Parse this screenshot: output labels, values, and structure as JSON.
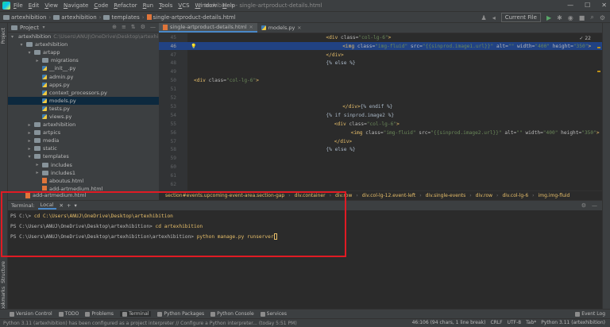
{
  "titlebar": {
    "menu": [
      "File",
      "Edit",
      "View",
      "Navigate",
      "Code",
      "Refactor",
      "Run",
      "Tools",
      "VCS",
      "Window",
      "Help"
    ],
    "window_title": "artexhibition - single-artproduct-details.html"
  },
  "navbar": {
    "crumbs": [
      "artexhibition",
      "artexhibition",
      "templates",
      "single-artproduct-details.html"
    ],
    "run_config": "Current File"
  },
  "sidebar": {
    "project_label": "Project",
    "structure_label": "Structure",
    "bookmarks_label": "Bookmarks",
    "tree": [
      {
        "label": "artexhibition",
        "path": "C:\\Users\\ANUJ\\OneDrive\\Desktop\\artexhibition",
        "type": "folder",
        "arrow": "▾",
        "indent": 0
      },
      {
        "label": "artexhibition",
        "type": "folder",
        "arrow": "▾",
        "indent": 1
      },
      {
        "label": "artapp",
        "type": "folder",
        "arrow": "▾",
        "indent": 2
      },
      {
        "label": "migrations",
        "type": "folder",
        "arrow": "▸",
        "indent": 3
      },
      {
        "label": "__init__.py",
        "type": "py",
        "arrow": "",
        "indent": 3
      },
      {
        "label": "admin.py",
        "type": "py",
        "arrow": "",
        "indent": 3
      },
      {
        "label": "apps.py",
        "type": "py",
        "arrow": "",
        "indent": 3
      },
      {
        "label": "context_processors.py",
        "type": "py",
        "arrow": "",
        "indent": 3
      },
      {
        "label": "models.py",
        "type": "py",
        "arrow": "",
        "indent": 3,
        "selected": true
      },
      {
        "label": "tests.py",
        "type": "py",
        "arrow": "",
        "indent": 3
      },
      {
        "label": "views.py",
        "type": "py",
        "arrow": "",
        "indent": 3
      },
      {
        "label": "artexhibition",
        "type": "folder",
        "arrow": "▸",
        "indent": 2
      },
      {
        "label": "artpics",
        "type": "folder",
        "arrow": "▸",
        "indent": 2
      },
      {
        "label": "media",
        "type": "folder",
        "arrow": "▸",
        "indent": 2
      },
      {
        "label": "static",
        "type": "folder",
        "arrow": "▸",
        "indent": 2
      },
      {
        "label": "templates",
        "type": "folder",
        "arrow": "▾",
        "indent": 2
      },
      {
        "label": "includes",
        "type": "folder",
        "arrow": "▸",
        "indent": 3
      },
      {
        "label": "includes1",
        "type": "folder",
        "arrow": "▸",
        "indent": 3
      },
      {
        "label": "aboutus.html",
        "type": "html",
        "arrow": "",
        "indent": 3
      },
      {
        "label": "add-artmedium.html",
        "type": "html",
        "arrow": "",
        "indent": 3
      }
    ],
    "extra_item": "add-artmedium.html"
  },
  "editor": {
    "tabs": [
      {
        "label": "single-artproduct-details.html",
        "active": true
      },
      {
        "label": "models.py",
        "active": false
      }
    ],
    "inspection": "✓ 22",
    "lines": [
      {
        "num": "45",
        "indent": 32,
        "segments": [
          {
            "t": "<div ",
            "c": "tag"
          },
          {
            "t": "class=",
            "c": "attr"
          },
          {
            "t": "\"col-lg-6\"",
            "c": "str"
          },
          {
            "t": ">",
            "c": "tag"
          }
        ]
      },
      {
        "num": "46",
        "indent": 36,
        "hl": true,
        "segments": [
          {
            "t": "<img ",
            "c": "tag"
          },
          {
            "t": "class=",
            "c": "attr"
          },
          {
            "t": "\"img-fluid\" ",
            "c": "str"
          },
          {
            "t": "src=",
            "c": "attr"
          },
          {
            "t": "\"{{sinprod.image1.url}}\" ",
            "c": "str"
          },
          {
            "t": "alt=",
            "c": "attr"
          },
          {
            "t": "\"\" ",
            "c": "str"
          },
          {
            "t": "width=",
            "c": "attr"
          },
          {
            "t": "\"400\" ",
            "c": "str"
          },
          {
            "t": "height=",
            "c": "attr"
          },
          {
            "t": "\"350\"",
            "c": "str"
          },
          {
            "t": ">",
            "c": "tag"
          }
        ]
      },
      {
        "num": "47",
        "indent": 32,
        "segments": [
          {
            "t": "</div>",
            "c": "tag"
          }
        ]
      },
      {
        "num": "48",
        "indent": 32,
        "segments": [
          {
            "t": "{% else %}",
            "c": "text"
          }
        ]
      },
      {
        "num": "49",
        "indent": 0,
        "segments": []
      },
      {
        "num": "50",
        "indent": 0,
        "segments": [
          {
            "t": "<div ",
            "c": "tag"
          },
          {
            "t": "class=",
            "c": "attr"
          },
          {
            "t": "\"col-lg-6\"",
            "c": "str"
          },
          {
            "t": ">",
            "c": "tag"
          }
        ]
      },
      {
        "num": "51",
        "indent": 0,
        "segments": []
      },
      {
        "num": "52",
        "indent": 0,
        "segments": []
      },
      {
        "num": "53",
        "indent": 36,
        "segments": [
          {
            "t": "</div>",
            "c": "tag"
          },
          {
            "t": "{% endif %}",
            "c": "text"
          }
        ]
      },
      {
        "num": "54",
        "indent": 32,
        "segments": [
          {
            "t": "{% if ",
            "c": "text"
          },
          {
            "t": "sinprod",
            "c": "text"
          },
          {
            "t": ".image2 %}",
            "c": "text"
          }
        ]
      },
      {
        "num": "55",
        "indent": 34,
        "segments": [
          {
            "t": "<div ",
            "c": "tag"
          },
          {
            "t": "class=",
            "c": "attr"
          },
          {
            "t": "\"col-lg-6\"",
            "c": "str"
          },
          {
            "t": ">",
            "c": "tag"
          }
        ]
      },
      {
        "num": "56",
        "indent": 38,
        "segments": [
          {
            "t": "<img ",
            "c": "tag"
          },
          {
            "t": "class=",
            "c": "attr"
          },
          {
            "t": "\"img-fluid\" ",
            "c": "str"
          },
          {
            "t": "src=",
            "c": "attr"
          },
          {
            "t": "\"{{sinprod.image2.url}}\" ",
            "c": "str"
          },
          {
            "t": "alt=",
            "c": "attr"
          },
          {
            "t": "\"\" ",
            "c": "str"
          },
          {
            "t": "width=",
            "c": "attr"
          },
          {
            "t": "\"400\" ",
            "c": "str"
          },
          {
            "t": "height=",
            "c": "attr"
          },
          {
            "t": "\"350\"",
            "c": "str"
          },
          {
            "t": ">",
            "c": "tag"
          }
        ]
      },
      {
        "num": "57",
        "indent": 34,
        "segments": [
          {
            "t": "</div>",
            "c": "tag"
          }
        ]
      },
      {
        "num": "58",
        "indent": 32,
        "segments": [
          {
            "t": "{% else %}",
            "c": "text"
          }
        ]
      },
      {
        "num": "59",
        "indent": 0,
        "segments": []
      },
      {
        "num": "60",
        "indent": 0,
        "segments": []
      },
      {
        "num": "61",
        "indent": 0,
        "segments": []
      },
      {
        "num": "62",
        "indent": 0,
        "segments": []
      }
    ],
    "html_crumbs": [
      "section#events.upcoming-event-area.section-gap",
      "div.container",
      "div.row",
      "div.col-lg-12.event-left",
      "div.single-events",
      "div.row",
      "div.col-lg-6",
      "img.img-fluid"
    ]
  },
  "terminal": {
    "label": "Terminal:",
    "tab": "Local",
    "lines": [
      {
        "prompt": "PS C:\\> ",
        "cmd": "cd C:\\Users\\ANUJ\\OneDrive\\Desktop\\artexhibition"
      },
      {
        "prompt": "PS C:\\Users\\ANUJ\\OneDrive\\Desktop\\artexhibition> ",
        "cmd": "cd artexhibition"
      },
      {
        "prompt": "PS C:\\Users\\ANUJ\\OneDrive\\Desktop\\artexhibition\\artexhibition> ",
        "cmd": "python manage.py runserver"
      }
    ]
  },
  "toolwindows": [
    "Version Control",
    "TODO",
    "Problems",
    "Terminal",
    "Python Packages",
    "Python Console",
    "Services"
  ],
  "event_log": "Event Log",
  "status": {
    "message": "Python 3.11 (artexhibition) has been configured as a project interpreter // Configure a Python interpreter... (today 5:51 PM)",
    "right": [
      "46:106 (94 chars, 1 line break)",
      "CRLF",
      "UTF-8",
      "Tab*",
      "Python 3.11 (artexhibition)"
    ]
  },
  "colors": {
    "tag": "#e8bf6a",
    "attr": "#bababa",
    "str": "#6a8759",
    "text": "#a9b7c6",
    "accent": "#4a88c7",
    "highlight": "#e01b24"
  }
}
